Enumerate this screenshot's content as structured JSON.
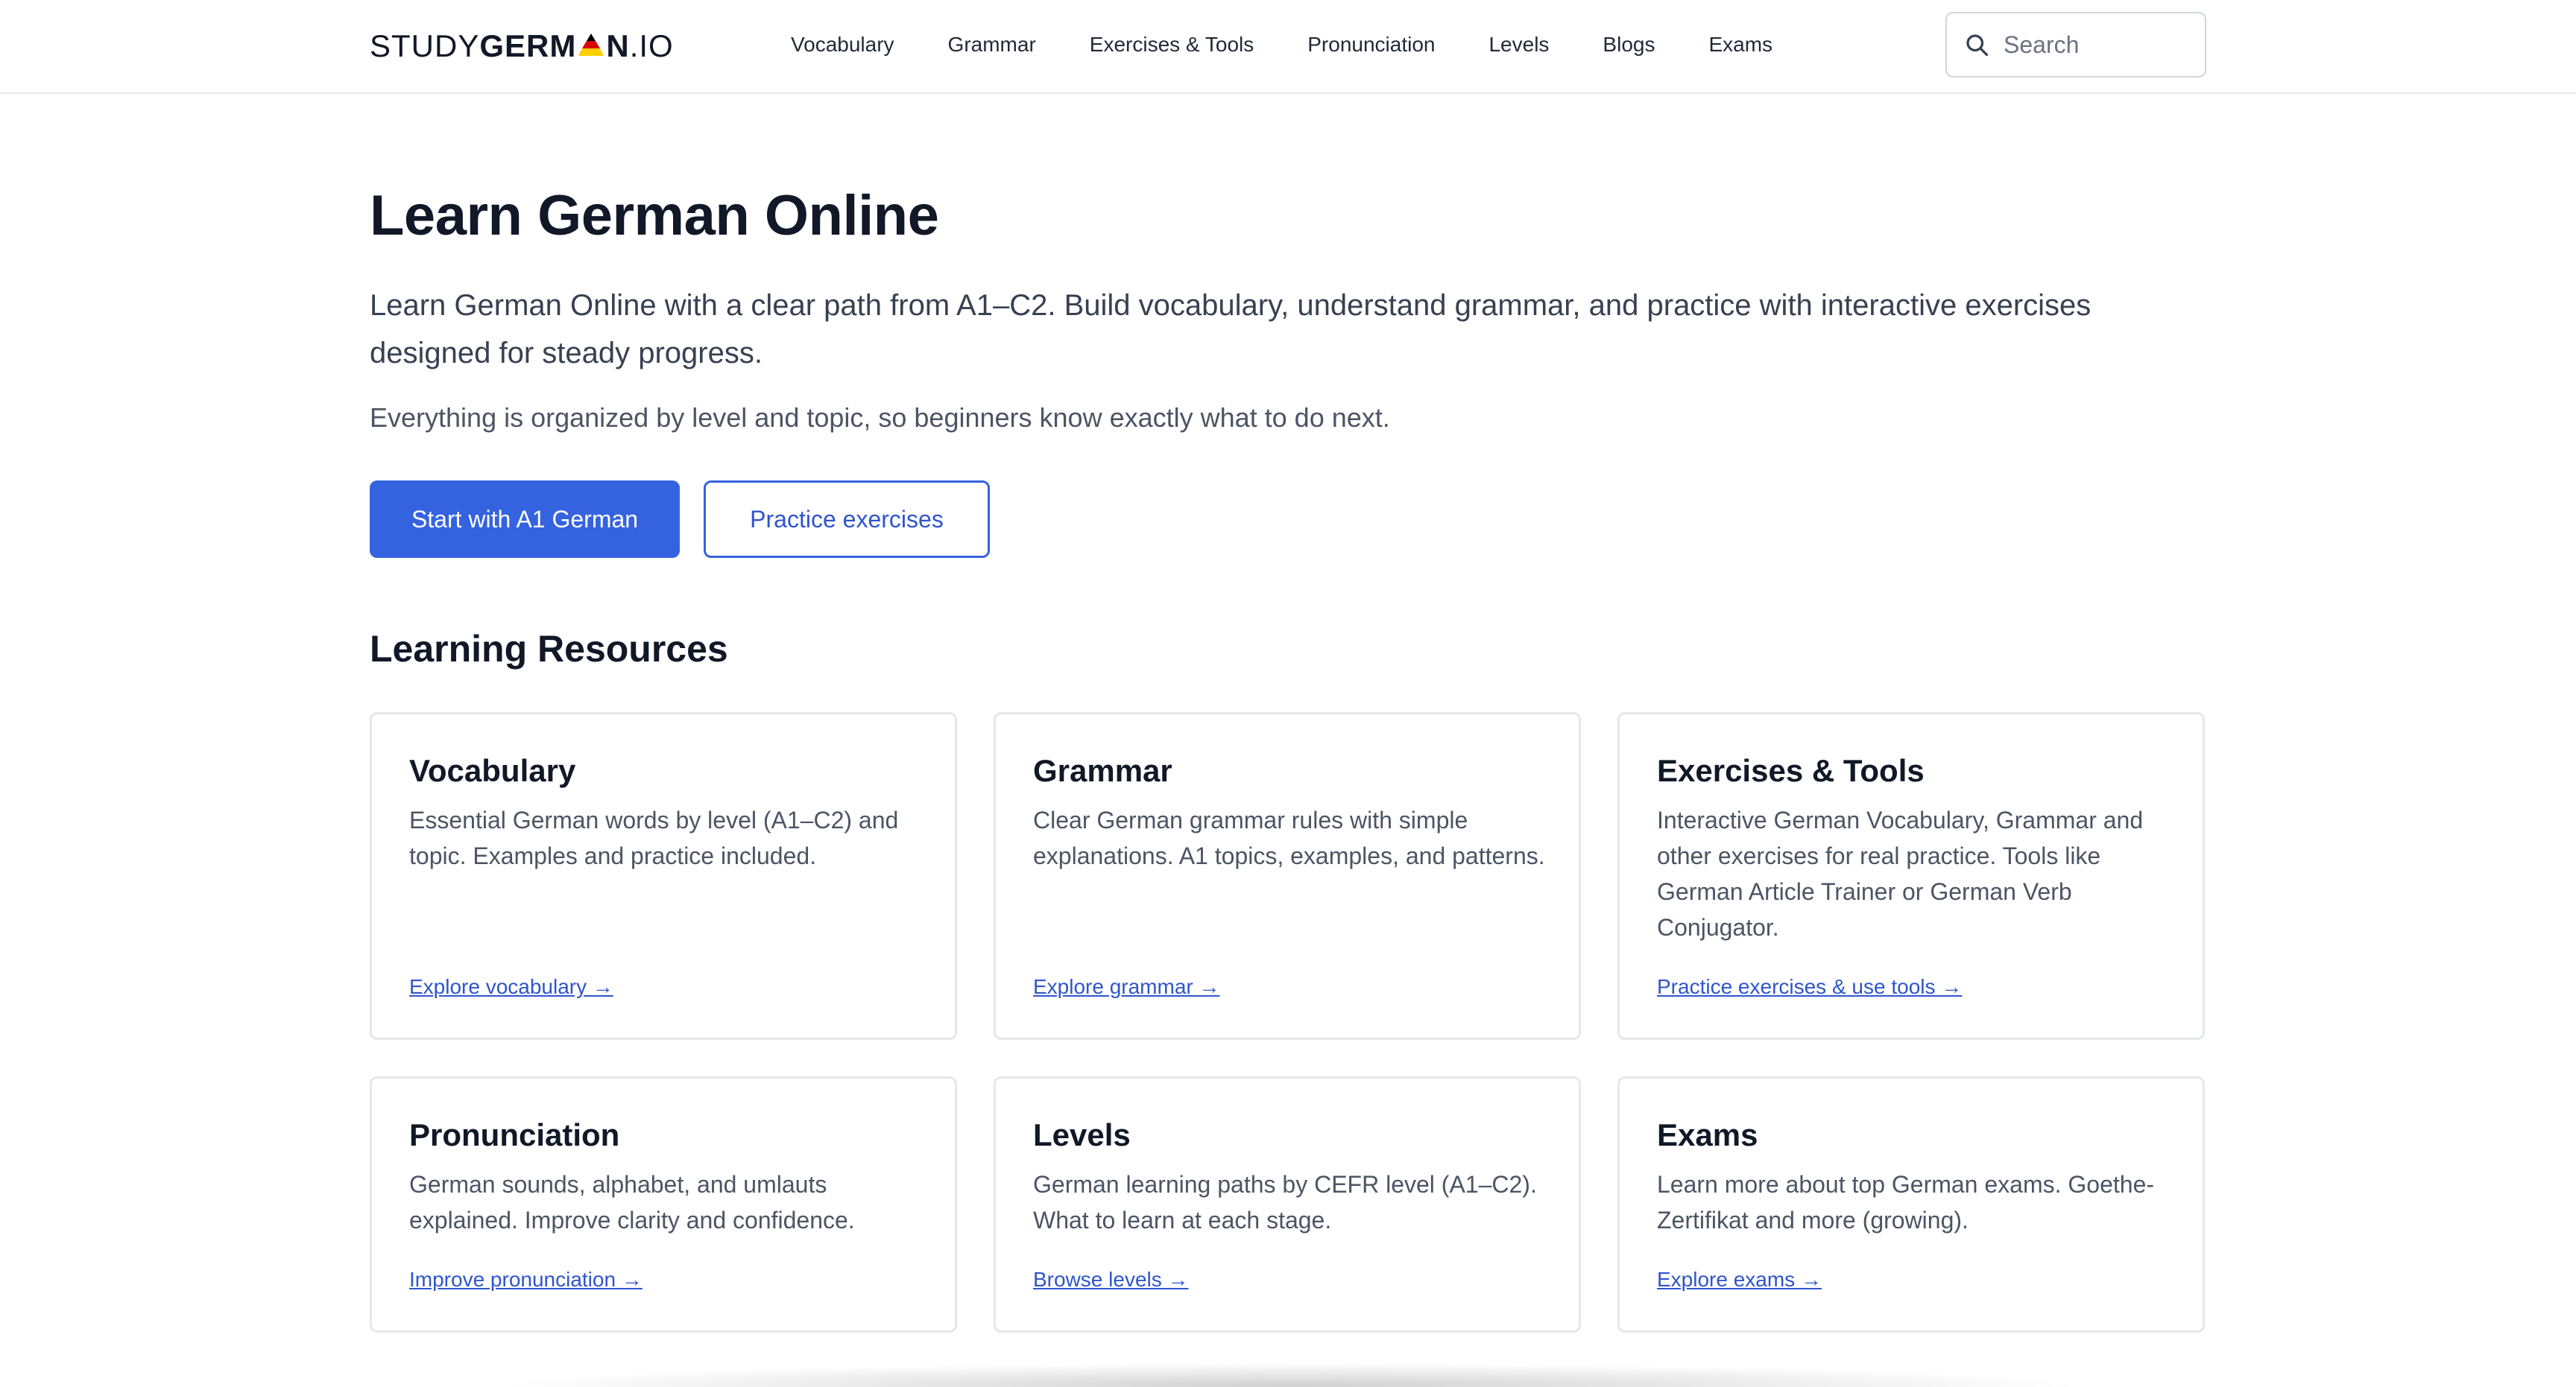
{
  "header": {
    "logo": {
      "part1": "STUDY",
      "part2": "GERM",
      "part3": "N",
      "part4": ".IO"
    },
    "nav": [
      "Vocabulary",
      "Grammar",
      "Exercises & Tools",
      "Pronunciation",
      "Levels",
      "Blogs",
      "Exams"
    ],
    "search_placeholder": "Search"
  },
  "hero": {
    "title": "Learn German Online",
    "lead": "Learn German Online with a clear path from A1–C2. Build vocabulary, understand grammar, and practice with interactive exercises designed for steady progress.",
    "sub": "Everything is organized by level and topic, so beginners know exactly what to do next.",
    "primary_button": "Start with A1 German",
    "secondary_button": "Practice exercises"
  },
  "resources": {
    "title": "Learning Resources",
    "cards": [
      {
        "title": "Vocabulary",
        "text": "Essential German words by level (A1–C2) and topic. Examples and practice included.",
        "link": "Explore vocabulary →"
      },
      {
        "title": "Grammar",
        "text": "Clear German grammar rules with simple explanations. A1 topics, examples, and patterns.",
        "link": "Explore grammar →"
      },
      {
        "title": "Exercises & Tools",
        "text": "Interactive German Vocabulary, Grammar and other exercises for real practice. Tools like German Article Trainer or German Verb Conjugator.",
        "link": "Practice exercises & use tools →"
      },
      {
        "title": "Pronunciation",
        "text": "German sounds, alphabet, and umlauts explained. Improve clarity and confidence.",
        "link": "Improve pronunciation →"
      },
      {
        "title": "Levels",
        "text": "German learning paths by CEFR level (A1–C2). What to learn at each stage.",
        "link": "Browse levels →"
      },
      {
        "title": "Exams",
        "text": "Learn more about top German exams. Goethe-Zertifikat and more (growing).",
        "link": "Explore exams →"
      }
    ]
  },
  "colors": {
    "accent": "#3563e0",
    "link": "#2f55cc",
    "flag_black": "#000000",
    "flag_red": "#dd0000",
    "flag_gold": "#ffce00"
  }
}
